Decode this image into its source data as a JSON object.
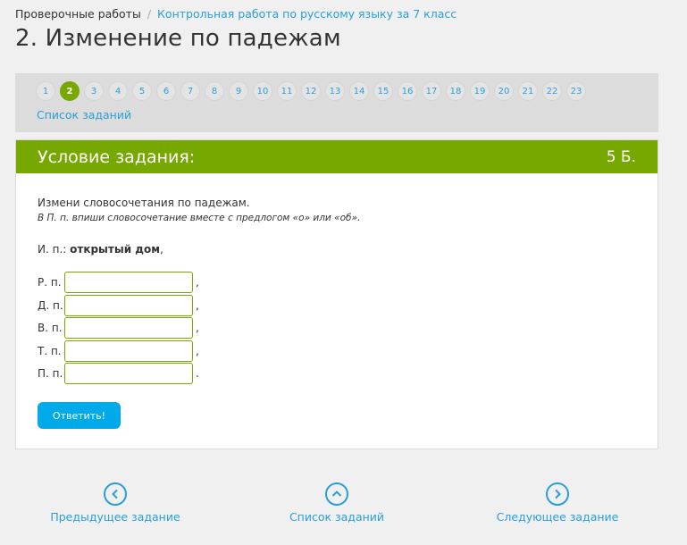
{
  "breadcrumb": {
    "home": "Проверочные работы",
    "separator": "/",
    "current": "Контрольная работа по русскому языку за 7 класс"
  },
  "page_title": "2. Изменение по падежам",
  "pager": {
    "pages": [
      "1",
      "2",
      "3",
      "4",
      "5",
      "6",
      "7",
      "8",
      "9",
      "10",
      "11",
      "12",
      "13",
      "14",
      "15",
      "16",
      "17",
      "18",
      "19",
      "20",
      "21",
      "22",
      "23"
    ],
    "active": "2",
    "task_list_link": "Список заданий"
  },
  "card": {
    "title": "Условие задания:",
    "points": "5 Б.",
    "instruction": "Измени словосочетания по падежам.",
    "hint": "В П. п. впиши словосочетание вместе с предлогом «о» или «об».",
    "nominative_label": "И. п.: ",
    "nominative_value": "открытый дом",
    "nominative_punct": ",",
    "rows": [
      {
        "label": "Р. п.",
        "value": "",
        "punct": ","
      },
      {
        "label": "Д. п.",
        "value": "",
        "punct": ","
      },
      {
        "label": "В. п.",
        "value": "",
        "punct": ","
      },
      {
        "label": "Т. п.",
        "value": "",
        "punct": ","
      },
      {
        "label": "П. п.",
        "value": "",
        "punct": "."
      }
    ],
    "answer_button": "Ответить!"
  },
  "bottom_nav": {
    "prev": "Предыдущее задание",
    "list": "Список заданий",
    "next": "Следующее задание"
  },
  "colors": {
    "accent_green": "#76a800",
    "link_blue": "#2a9fd6",
    "button_blue": "#00a9e8"
  }
}
